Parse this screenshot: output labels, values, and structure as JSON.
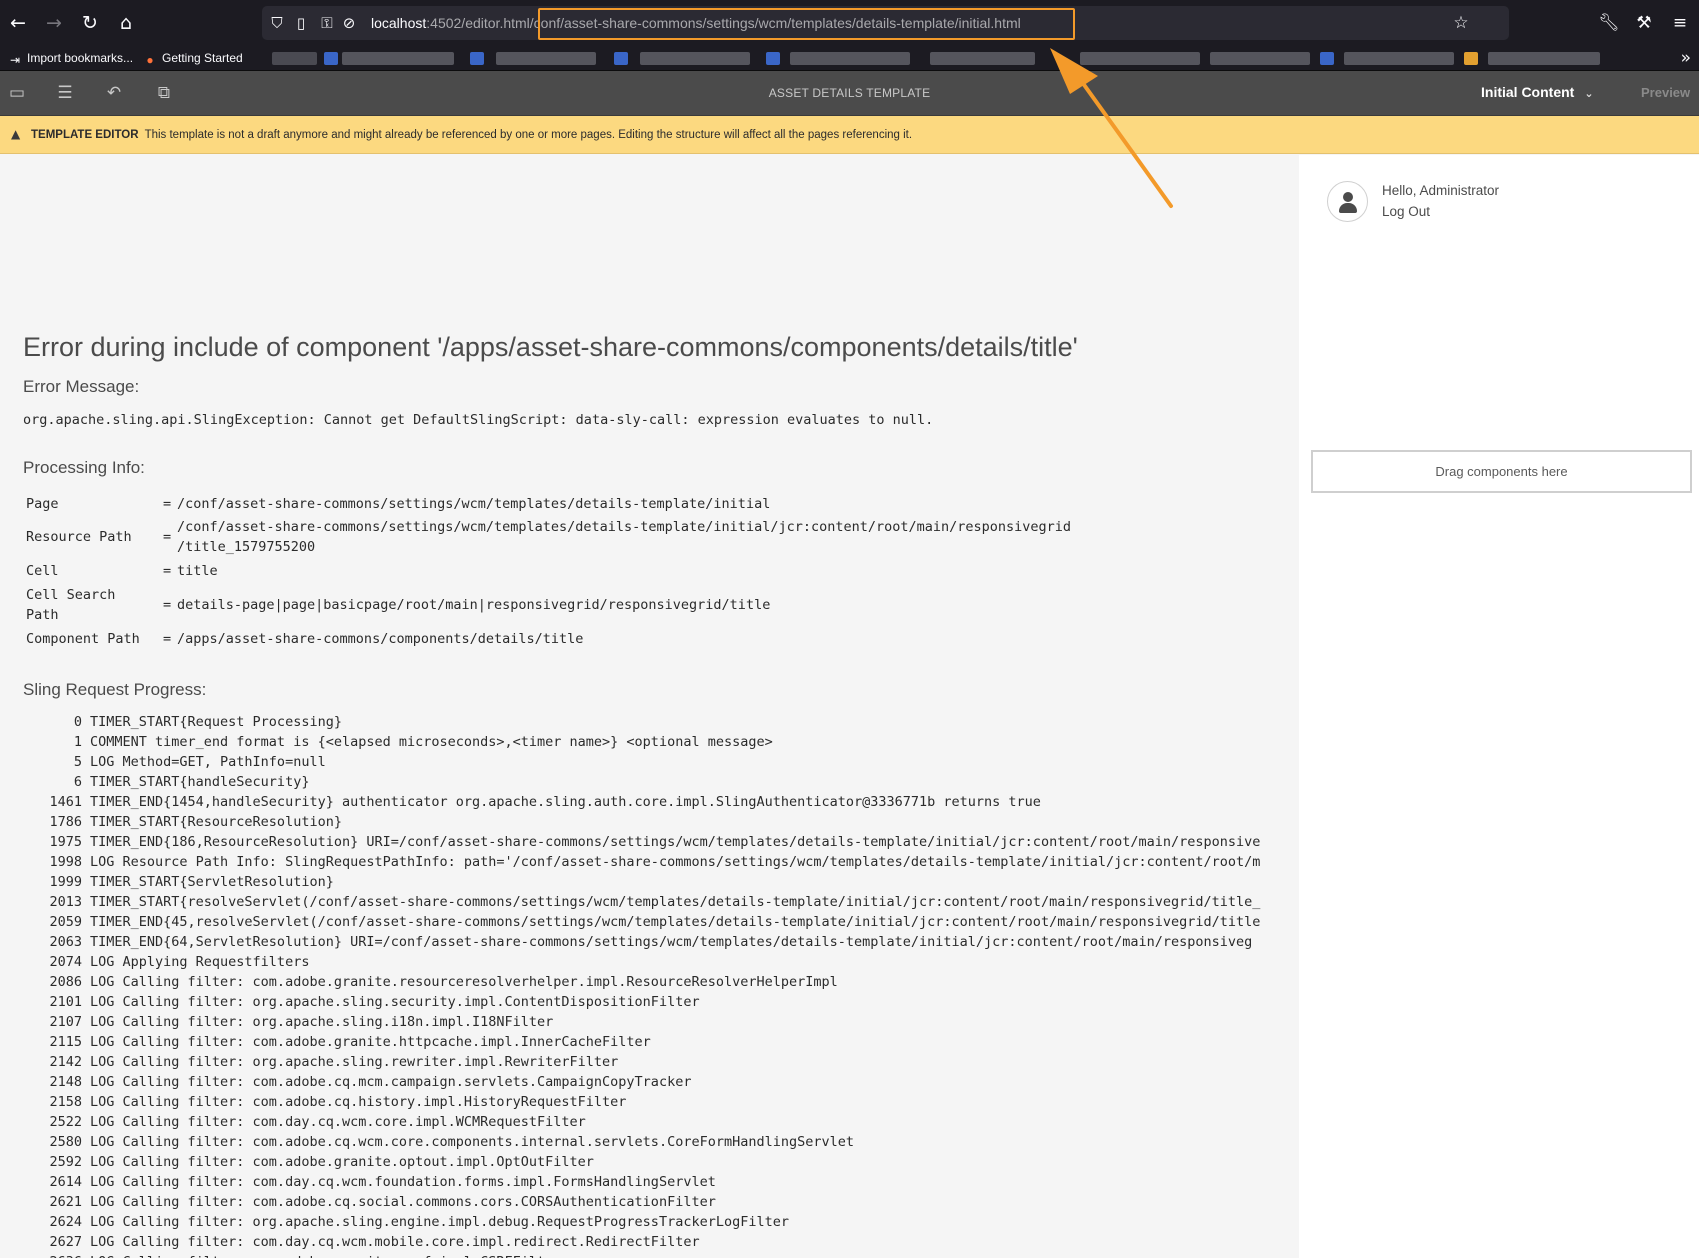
{
  "browser": {
    "url_host": "localhost",
    "url_port_path": ":4502/editor.html",
    "url_highlighted": "/conf/asset-share-commons/settings/wcm/templates/details-template/initial.html",
    "bookmarks": [
      {
        "label": "Import bookmarks..."
      },
      {
        "label": "Getting Started"
      }
    ]
  },
  "editor": {
    "title": "ASSET DETAILS TEMPLATE",
    "mode": "Initial Content",
    "preview_label": "Preview"
  },
  "alert": {
    "title": "TEMPLATE EDITOR",
    "message": "This template is not a draft anymore and might already be referenced by one or more pages. Editing the structure will affect all the pages referencing it."
  },
  "error": {
    "title": "Error during include of component '/apps/asset-share-commons/components/details/title'",
    "message_heading": "Error Message:",
    "message": "org.apache.sling.api.SlingException: Cannot get DefaultSlingScript: data-sly-call: expression evaluates to null.",
    "processing_heading": "Processing Info:",
    "processing_info": [
      {
        "label": "Page",
        "value": "/conf/asset-share-commons/settings/wcm/templates/details-template/initial"
      },
      {
        "label": "Resource Path",
        "value": "/conf/asset-share-commons/settings/wcm/templates/details-template/initial/jcr:content/root/main/responsivegrid",
        "value2": "/title_1579755200"
      },
      {
        "label": "Cell",
        "value": "title"
      },
      {
        "label": "Cell Search",
        "label2": "Path",
        "value": "details-page|page|basicpage/root/main|responsivegrid/responsivegrid/title"
      },
      {
        "label": "Component Path",
        "value": "/apps/asset-share-commons/components/details/title"
      }
    ],
    "progress_heading": "Sling Request Progress:",
    "progress": [
      {
        "t": "0",
        "msg": "TIMER_START{Request Processing}"
      },
      {
        "t": "1",
        "msg": "COMMENT timer_end format is {<elapsed microseconds>,<timer name>} <optional message>"
      },
      {
        "t": "5",
        "msg": "LOG Method=GET, PathInfo=null"
      },
      {
        "t": "6",
        "msg": "TIMER_START{handleSecurity}"
      },
      {
        "t": "1461",
        "msg": "TIMER_END{1454,handleSecurity} authenticator org.apache.sling.auth.core.impl.SlingAuthenticator@3336771b returns true"
      },
      {
        "t": "1786",
        "msg": "TIMER_START{ResourceResolution}"
      },
      {
        "t": "1975",
        "msg": "TIMER_END{186,ResourceResolution} URI=/conf/asset-share-commons/settings/wcm/templates/details-template/initial/jcr:content/root/main/responsive"
      },
      {
        "t": "1998",
        "msg": "LOG Resource Path Info: SlingRequestPathInfo: path='/conf/asset-share-commons/settings/wcm/templates/details-template/initial/jcr:content/root/m"
      },
      {
        "t": "1999",
        "msg": "TIMER_START{ServletResolution}"
      },
      {
        "t": "2013",
        "msg": "TIMER_START{resolveServlet(/conf/asset-share-commons/settings/wcm/templates/details-template/initial/jcr:content/root/main/responsivegrid/title_"
      },
      {
        "t": "2059",
        "msg": "TIMER_END{45,resolveServlet(/conf/asset-share-commons/settings/wcm/templates/details-template/initial/jcr:content/root/main/responsivegrid/title"
      },
      {
        "t": "2063",
        "msg": "TIMER_END{64,ServletResolution} URI=/conf/asset-share-commons/settings/wcm/templates/details-template/initial/jcr:content/root/main/responsiveg"
      },
      {
        "t": "2074",
        "msg": "LOG Applying Requestfilters"
      },
      {
        "t": "2086",
        "msg": "LOG Calling filter: com.adobe.granite.resourceresolverhelper.impl.ResourceResolverHelperImpl"
      },
      {
        "t": "2101",
        "msg": "LOG Calling filter: org.apache.sling.security.impl.ContentDispositionFilter"
      },
      {
        "t": "2107",
        "msg": "LOG Calling filter: org.apache.sling.i18n.impl.I18NFilter"
      },
      {
        "t": "2115",
        "msg": "LOG Calling filter: com.adobe.granite.httpcache.impl.InnerCacheFilter"
      },
      {
        "t": "2142",
        "msg": "LOG Calling filter: org.apache.sling.rewriter.impl.RewriterFilter"
      },
      {
        "t": "2148",
        "msg": "LOG Calling filter: com.adobe.cq.mcm.campaign.servlets.CampaignCopyTracker"
      },
      {
        "t": "2158",
        "msg": "LOG Calling filter: com.adobe.cq.history.impl.HistoryRequestFilter"
      },
      {
        "t": "2522",
        "msg": "LOG Calling filter: com.day.cq.wcm.core.impl.WCMRequestFilter"
      },
      {
        "t": "2580",
        "msg": "LOG Calling filter: com.adobe.cq.wcm.core.components.internal.servlets.CoreFormHandlingServlet"
      },
      {
        "t": "2592",
        "msg": "LOG Calling filter: com.adobe.granite.optout.impl.OptOutFilter"
      },
      {
        "t": "2614",
        "msg": "LOG Calling filter: com.day.cq.wcm.foundation.forms.impl.FormsHandlingServlet"
      },
      {
        "t": "2621",
        "msg": "LOG Calling filter: com.adobe.cq.social.commons.cors.CORSAuthenticationFilter"
      },
      {
        "t": "2624",
        "msg": "LOG Calling filter: org.apache.sling.engine.impl.debug.RequestProgressTrackerLogFilter"
      },
      {
        "t": "2627",
        "msg": "LOG Calling filter: com.day.cq.wcm.mobile.core.impl.redirect.RedirectFilter"
      },
      {
        "t": "2636",
        "msg": "LOG Calling filter: com.adobe.granite.csrf.impl.CSRFFilter"
      }
    ]
  },
  "side_panel": {
    "greeting": "Hello, Administrator",
    "logout": "Log Out",
    "drop_zone": "Drag components here"
  },
  "colors": {
    "alert_bg": "#fcd980",
    "editor_bar": "#4b4b4b",
    "highlight_orange": "#f39a2a"
  }
}
